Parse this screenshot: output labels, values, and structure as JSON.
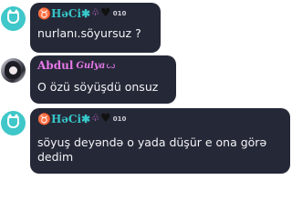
{
  "messages": [
    {
      "sender": "♉HəCi✱",
      "badges": {
        "deco": "♧",
        "heart": "♥",
        "level": "010"
      },
      "text": "nurlanı.söyursuz ?"
    },
    {
      "sender": "Abdul",
      "sender_suffix": "Gulya",
      "badges": {
        "deco": "ꙍ"
      },
      "text": "O özü söyüşdü onsuz"
    },
    {
      "sender": "♉HəCi✱",
      "badges": {
        "deco": "♧",
        "heart": "♥",
        "level": "010"
      },
      "text": "söyuş deyəndə o yada düşür e ona görə dedim"
    }
  ],
  "colors": {
    "bubble": "#252837",
    "teal": "#36c6c8",
    "pink": "#e678e9",
    "text": "#f4f4f7"
  }
}
